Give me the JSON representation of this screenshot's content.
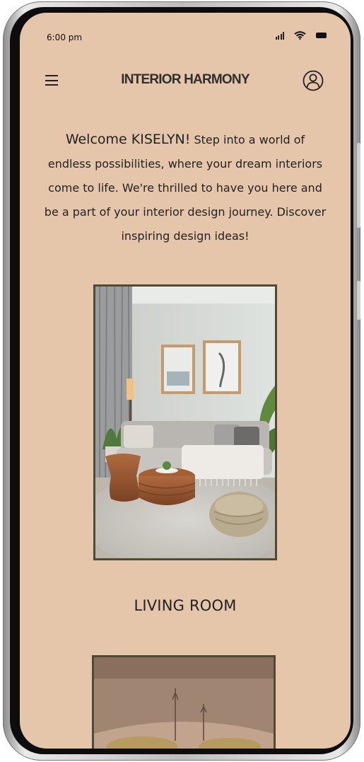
{
  "status_bar": {
    "time": "6:00 pm",
    "icons": [
      "signal-icon",
      "wifi-icon",
      "battery-icon"
    ]
  },
  "header": {
    "title": "INTERIOR HARMONY",
    "menu_icon": "hamburger-menu-icon",
    "profile_icon": "user-profile-icon"
  },
  "welcome": {
    "greeting": "Welcome KISELYN!",
    "message": "Step into a world of endless possibilities, where your dream interiors come to life. We're thrilled to have you here and be a part of your interior design journey. Discover inspiring design ideas!"
  },
  "rooms": [
    {
      "label": "LIVING ROOM"
    }
  ],
  "colors": {
    "screen_background": "#e5c6aa",
    "card_border": "#4c4c34",
    "text": "#222222"
  }
}
